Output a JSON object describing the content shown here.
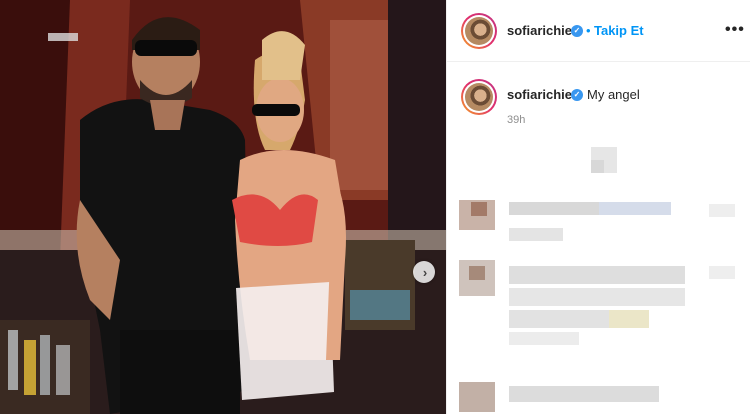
{
  "post": {
    "username": "sofiarichie",
    "follow_label": "Takip Et",
    "separator": "•",
    "more_label": "•••",
    "caption_username": "sofiarichie",
    "caption_text": "My angel",
    "timestamp": "39h",
    "next_label": "›"
  },
  "colors": {
    "follow_blue": "#0095f6",
    "verified_blue": "#3897f0",
    "timestamp_gray": "#8e8e8e"
  },
  "icons": {
    "verified": "verified-badge-icon",
    "next": "chevron-right-icon",
    "more": "more-options-icon"
  }
}
